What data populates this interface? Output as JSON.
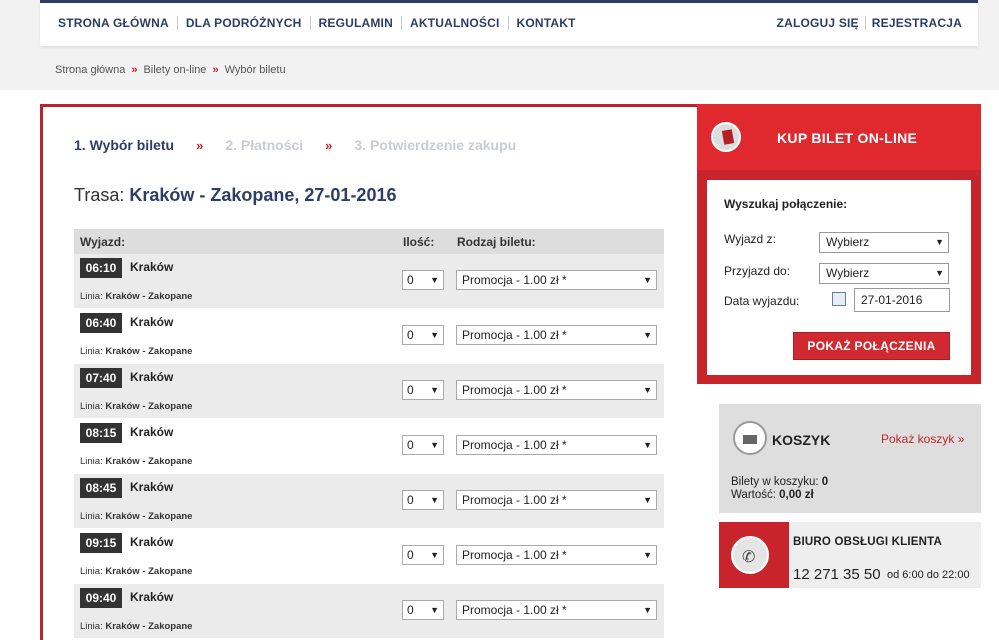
{
  "nav": {
    "left": [
      "STRONA GŁÓWNA",
      "DLA PODRÓŻNYCH",
      "REGULAMIN",
      "AKTUALNOŚCI",
      "KONTAKT"
    ],
    "right": [
      "ZALOGUJ SIĘ",
      "REJESTRACJA"
    ]
  },
  "breadcrumb": [
    "Strona główna",
    "Bilety on-line",
    "Wybór biletu"
  ],
  "breadcrumb_sep": "»",
  "steps": [
    "1. Wybór biletu",
    "2. Płatności",
    "3. Potwierdzenie zakupu"
  ],
  "step_sep": "»",
  "route": {
    "label": "Trasa:",
    "value": "Kraków - Zakopane, 27-01-2016"
  },
  "table": {
    "headers": {
      "wyjazd": "Wyjazd:",
      "ilosc": "Ilość:",
      "rodzaj": "Rodzaj biletu:"
    },
    "line_label": "Linia:",
    "rows": [
      {
        "time": "06:10",
        "city": "Kraków",
        "line": "Kraków - Zakopane",
        "qty": "0",
        "ticket": "Promocja - 1.00 zł *"
      },
      {
        "time": "06:40",
        "city": "Kraków",
        "line": "Kraków - Zakopane",
        "qty": "0",
        "ticket": "Promocja - 1.00 zł *"
      },
      {
        "time": "07:40",
        "city": "Kraków",
        "line": "Kraków - Zakopane",
        "qty": "0",
        "ticket": "Promocja - 1.00 zł *"
      },
      {
        "time": "08:15",
        "city": "Kraków",
        "line": "Kraków - Zakopane",
        "qty": "0",
        "ticket": "Promocja - 1.00 zł *"
      },
      {
        "time": "08:45",
        "city": "Kraków",
        "line": "Kraków - Zakopane",
        "qty": "0",
        "ticket": "Promocja - 1.00 zł *"
      },
      {
        "time": "09:15",
        "city": "Kraków",
        "line": "Kraków - Zakopane",
        "qty": "0",
        "ticket": "Promocja - 1.00 zł *"
      },
      {
        "time": "09:40",
        "city": "Kraków",
        "line": "Kraków - Zakopane",
        "qty": "0",
        "ticket": "Promocja - 1.00 zł *"
      }
    ]
  },
  "kup": {
    "title": "KUP BILET ON-LINE",
    "heading": "Wyszukaj połączenie:",
    "from_label": "Wyjazd z:",
    "from_value": "Wybierz",
    "to_label": "Przyjazd do:",
    "to_value": "Wybierz",
    "date_label": "Data wyjazdu:",
    "date_value": "27-01-2016",
    "button": "POKAŻ POŁĄCZENIA"
  },
  "koszyk": {
    "title": "KOSZYK",
    "link": "Pokaż koszyk »",
    "tickets_label": "Bilety w koszyku:",
    "tickets_value": "0",
    "value_label": "Wartość:",
    "value_value": "0,00 zł"
  },
  "biuro": {
    "title": "BIURO OBSŁUGI KLIENTA",
    "phone": "12 271 35 50",
    "hours": "od 6:00 do 22:00"
  },
  "colors": {
    "navy": "#2c3e66",
    "red": "#c7242b",
    "accent_red": "#e0292f"
  }
}
